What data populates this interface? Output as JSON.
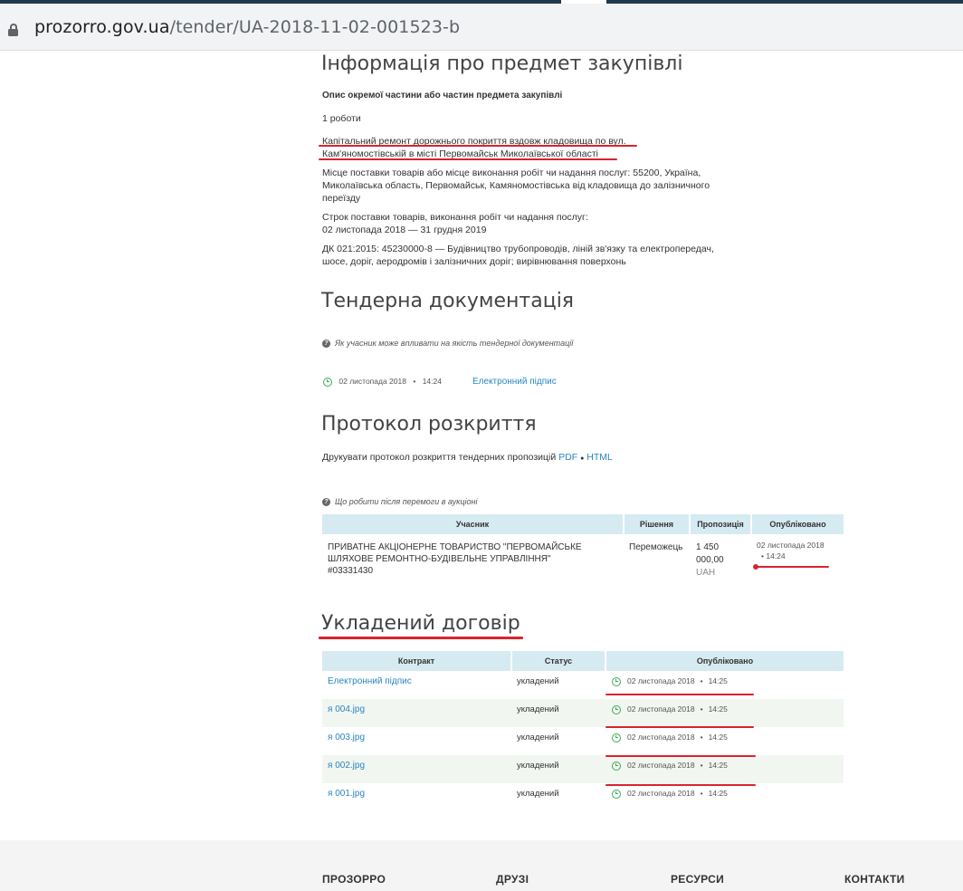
{
  "browser": {
    "url_domain": "prozorro.gov.ua",
    "url_path": "/tender/UA-2018-11-02-001523-b"
  },
  "subject": {
    "heading": "Інформація про предмет закупівлі",
    "desc_label": "Опис окремої частини або частин предмета закупівлі",
    "quantity": "1 роботи",
    "title_line1": "Капітальний ремонт дорожнього покриття вздовж кладовища по вул.",
    "title_line2": "Кам'яномостівській в місті Первомайськ Миколаївської області",
    "place_line1": "Місце поставки товарів або місце виконання робіт чи надання послуг: 55200, Україна,",
    "place_line2": "Миколаївська область, Первомайськ, Камяномостівська від кладовища до залізничного",
    "place_line3": "переїзду",
    "term_label": "Строк поставки товарів, виконання робіт чи надання послуг:",
    "term_value": "02 листопада 2018  —  31 грудня 2019",
    "dk_line1": "ДК 021:2015: 45230000-8 — Будівництво трубопроводів, ліній зв'язку та електропередач,",
    "dk_line2": "шосе, доріг, аеродромів і залізничних доріг; вирівнювання поверхонь"
  },
  "tender_docs": {
    "heading": "Тендерна документація",
    "help_link": "Як учасник може впливати на якість тендерної документації",
    "date": "02 листопада 2018",
    "time": "14:24",
    "doc_link": "Електронний підпис"
  },
  "protocol": {
    "heading": "Протокол розкриття",
    "print_text": "Друкувати протокол розкриття тендерних пропозицій",
    "pdf": "PDF",
    "html": "HTML",
    "sep": "●",
    "help_link": "Що робити після перемоги в аукціоні",
    "columns": [
      "Учасник",
      "Рішення",
      "Пропозиція",
      "Опубліковано"
    ],
    "row": {
      "participant_line1": "ПРИВАТНЕ АКЦІОНЕРНЕ ТОВАРИСТВО \"ПЕРВОМАЙСЬКЕ",
      "participant_line2": "ШЛЯХОВЕ РЕМОНТНО-БУДІВЕЛЬНЕ УПРАВЛІННЯ\"",
      "participant_line3": "#03331430",
      "decision": "Переможець",
      "offer_line1": "1 450",
      "offer_line2": "000,00",
      "currency": "UAH",
      "published_date": "02 листопада 2018",
      "published_time": "14:24"
    }
  },
  "contract": {
    "heading": "Укладений договір",
    "columns": [
      "Контракт",
      "Статус",
      "Опубліковано"
    ],
    "rows": [
      {
        "name": "Електронний підпис",
        "status": "укладений",
        "date": "02 листопада 2018",
        "time": "14:25"
      },
      {
        "name": "я 004.jpg",
        "status": "укладений",
        "date": "02 листопада 2018",
        "time": "14:25"
      },
      {
        "name": "я 003.jpg",
        "status": "укладений",
        "date": "02 листопада 2018",
        "time": "14:25"
      },
      {
        "name": "я 002.jpg",
        "status": "укладений",
        "date": "02 листопада 2018",
        "time": "14:25"
      },
      {
        "name": "я 001.jpg",
        "status": "укладений",
        "date": "02 листопада 2018",
        "time": "14:25"
      }
    ]
  },
  "footer": {
    "col1": "ПРОЗОРРО",
    "col2": "ДРУЗІ",
    "col3": "РЕСУРСИ",
    "col4": "КОНТАКТИ"
  },
  "colors": {
    "link": "#2a86c0",
    "annotation_red": "#d9232f",
    "table_header": "#d6eaf1",
    "clock_green": "#3daa55"
  }
}
